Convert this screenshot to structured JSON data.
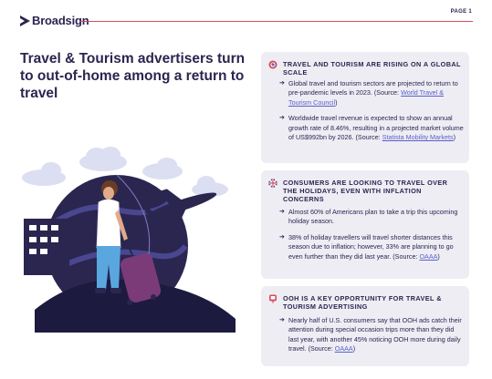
{
  "header": {
    "brand": "Broadsign",
    "page_label": "PAGE 1",
    "accent_color": "#d94a5a"
  },
  "headline": "Travel & Tourism advertisers turn to out-of-home among a return to travel",
  "cards": [
    {
      "icon": "globe-icon",
      "title": "TRAVEL AND TOURISM ARE RISING ON A GLOBAL SCALE",
      "bullets": [
        {
          "text": "Global travel and tourism sectors are projected to return to pre-pandemic levels in 2023. (Source: ",
          "link": "World Travel & Tourism Council",
          "tail": ")"
        },
        {
          "text": "Worldwide travel revenue is expected to show an annual growth rate of 8.46%, resulting in a projected market volume of US$992bn by 2026. (Source: ",
          "link": "Statista Mobility Markets",
          "tail": ")"
        }
      ]
    },
    {
      "icon": "uk-flag-icon",
      "title": "CONSUMERS ARE LOOKING TO TRAVEL OVER THE HOLIDAYS, EVEN WITH INFLATION CONCERNS",
      "bullets": [
        {
          "text": "Almost 60% of Americans plan to take a trip this upcoming holiday season.",
          "link": "",
          "tail": ""
        },
        {
          "text": "38% of holiday travellers will travel shorter distances this season due to inflation; however, 33% are planning to go even further than they did last year. (Source: ",
          "link": "OAAA",
          "tail": ")"
        }
      ]
    },
    {
      "icon": "billboard-icon",
      "title": "OOH IS A KEY OPPORTUNITY FOR TRAVEL & TOURISM ADVERTISING",
      "bullets": [
        {
          "text": "Nearly half of U.S. consumers say that OOH ads catch their attention during special occasion trips more than they did last year, with another 45% noticing OOH more during daily travel. (Source: ",
          "link": "OAAA",
          "tail": ")"
        }
      ]
    }
  ],
  "colors": {
    "navy": "#2a2650",
    "card_bg": "#eeedf4",
    "link": "#5860c8",
    "cloud": "#dcdff2"
  }
}
